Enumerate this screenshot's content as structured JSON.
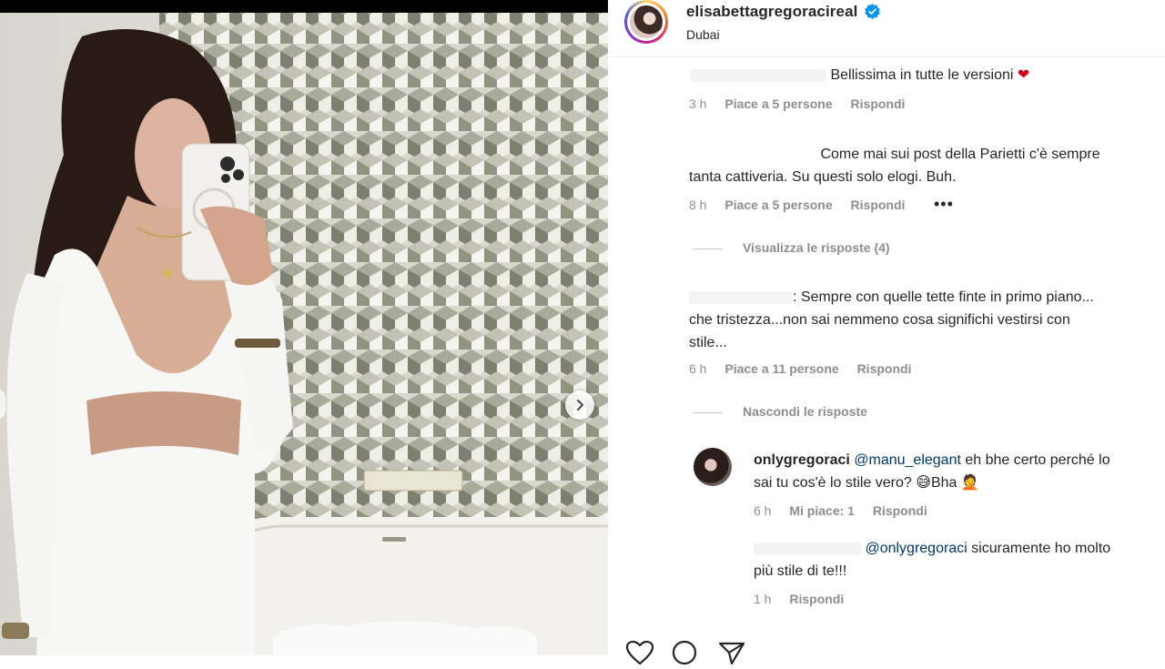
{
  "post": {
    "username": "elisabettagregoracireal",
    "location": "Dubai",
    "verified_icon": "verified-badge-icon",
    "brand_accent": "#0095f6"
  },
  "comments": [
    {
      "text": "Bellissima in tutte le versioni",
      "emoji": "❤",
      "time": "3 h",
      "likes": "Piace a 5 persone",
      "reply": "Rispondi"
    },
    {
      "text_line1": "Come mai sui post della Parietti c'è sempre",
      "text_line2": "tanta cattiveria. Su questi solo elogi. Buh.",
      "time": "8 h",
      "likes": "Piace a 5 persone",
      "reply": "Rispondi",
      "more": "•••",
      "replies_toggle": "Visualizza le risposte (4)"
    },
    {
      "text_line1": ": Sempre con quelle tette finte in primo piano...",
      "text_line2": "che tristezza...non sai nemmeno cosa significhi vestirsi con",
      "text_line3": "stile...",
      "time": "6 h",
      "likes": "Piace a 11 persone",
      "reply": "Rispondi",
      "replies_toggle": "Nascondi le risposte"
    }
  ],
  "replies": [
    {
      "user": "onlygregoraci",
      "mention": "@manu_elegant",
      "text_line1": " eh bhe certo perché lo",
      "text_line2": "sai tu cos'è lo stile vero? ",
      "emoji1": "😅",
      "text_tail": "Bha ",
      "emoji2": "🤦",
      "time": "6 h",
      "likes": "Mi piace: 1",
      "reply": "Rispondi"
    },
    {
      "mention": "@onlygregoraci",
      "text_line1": " sicuramente ho molto",
      "text_line2": "più stile di te!!!",
      "time": "1 h",
      "reply": "Rispondi"
    }
  ],
  "actions": [
    "heart-icon",
    "comment-icon",
    "share-icon"
  ]
}
